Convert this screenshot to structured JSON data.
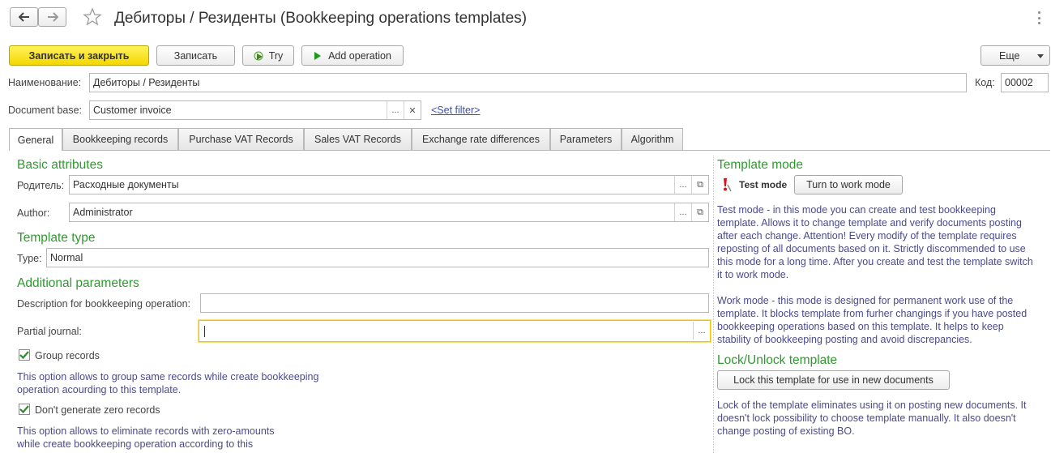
{
  "window": {
    "title": "Дебиторы / Резиденты (Bookkeeping operations templates)"
  },
  "toolbar": {
    "save_close": "Записать и закрыть",
    "save": "Записать",
    "try": "Try",
    "add_operation": "Add operation",
    "more": "Еще"
  },
  "header": {
    "name_label": "Наименование:",
    "name_value": "Дебиторы / Резиденты",
    "code_label": "Код:",
    "code_value": "00002",
    "doc_base_label": "Document base:",
    "doc_base_value": "Customer invoice",
    "set_filter": "<Set filter>"
  },
  "tabs": [
    {
      "label": "General",
      "active": true
    },
    {
      "label": "Bookkeeping records"
    },
    {
      "label": "Purchase VAT Records"
    },
    {
      "label": "Sales VAT Records"
    },
    {
      "label": "Exchange rate differences"
    },
    {
      "label": "Parameters"
    },
    {
      "label": "Algorithm"
    }
  ],
  "general": {
    "basic_attributes": "Basic attributes",
    "parent_label": "Родитель:",
    "parent_value": "Расходные документы",
    "author_label": "Author:",
    "author_value": "Administrator",
    "template_type": "Template type",
    "type_label": "Type:",
    "type_value": "Normal",
    "additional_parameters": "Additional parameters",
    "description_label": "Description for bookkeeping operation:",
    "description_value": "",
    "partial_journal_label": "Partial journal:",
    "partial_journal_value": "",
    "group_records_label": "Group records",
    "group_records_checked": true,
    "group_records_note": "This option allows to group same records while create bookkeeping operation acourding to this template.",
    "zero_records_label": "Don't generate zero records",
    "zero_records_checked": true,
    "zero_records_note": "This option allows to eliminate records with zero-amounts while create bookkeeping operation according to this"
  },
  "template_mode": {
    "title": "Template mode",
    "status": "Test mode",
    "turn_button": "Turn to work mode",
    "test_desc": "Test mode - in this mode you can create and test bookkeeping template. Allows it to change template and verify documents posting after each change. Attention! Every modify of the template requires reposting of all documents based on it. Strictly discommended to use this mode for a long time. After you create and test the template switch it to work mode.",
    "work_desc": "Work mode - this mode is designed for permanent work use of the template. It blocks template from furher changings if you have posted bookkeeping operations based on this template. It helps to keep stability of bookkeeping posting and avoid discrepancies."
  },
  "lock": {
    "title": "Lock/Unlock template",
    "button": "Lock this template for use in new documents",
    "desc": "Lock of the template eliminates using it on posting new documents. It doesn't lock possibility to choose template manually. It also doesn't change posting of existing BO."
  },
  "icons": {
    "back": "arrow-left-icon",
    "forward": "arrow-right-icon",
    "star": "star-icon",
    "try": "try-icon",
    "add": "play-icon",
    "warning": "exclamation-icon"
  },
  "colors": {
    "accent_green": "#2f9a2f",
    "note_text": "#4b4b8a",
    "primary_button": "#f4d700",
    "link": "#3b4fb8"
  }
}
